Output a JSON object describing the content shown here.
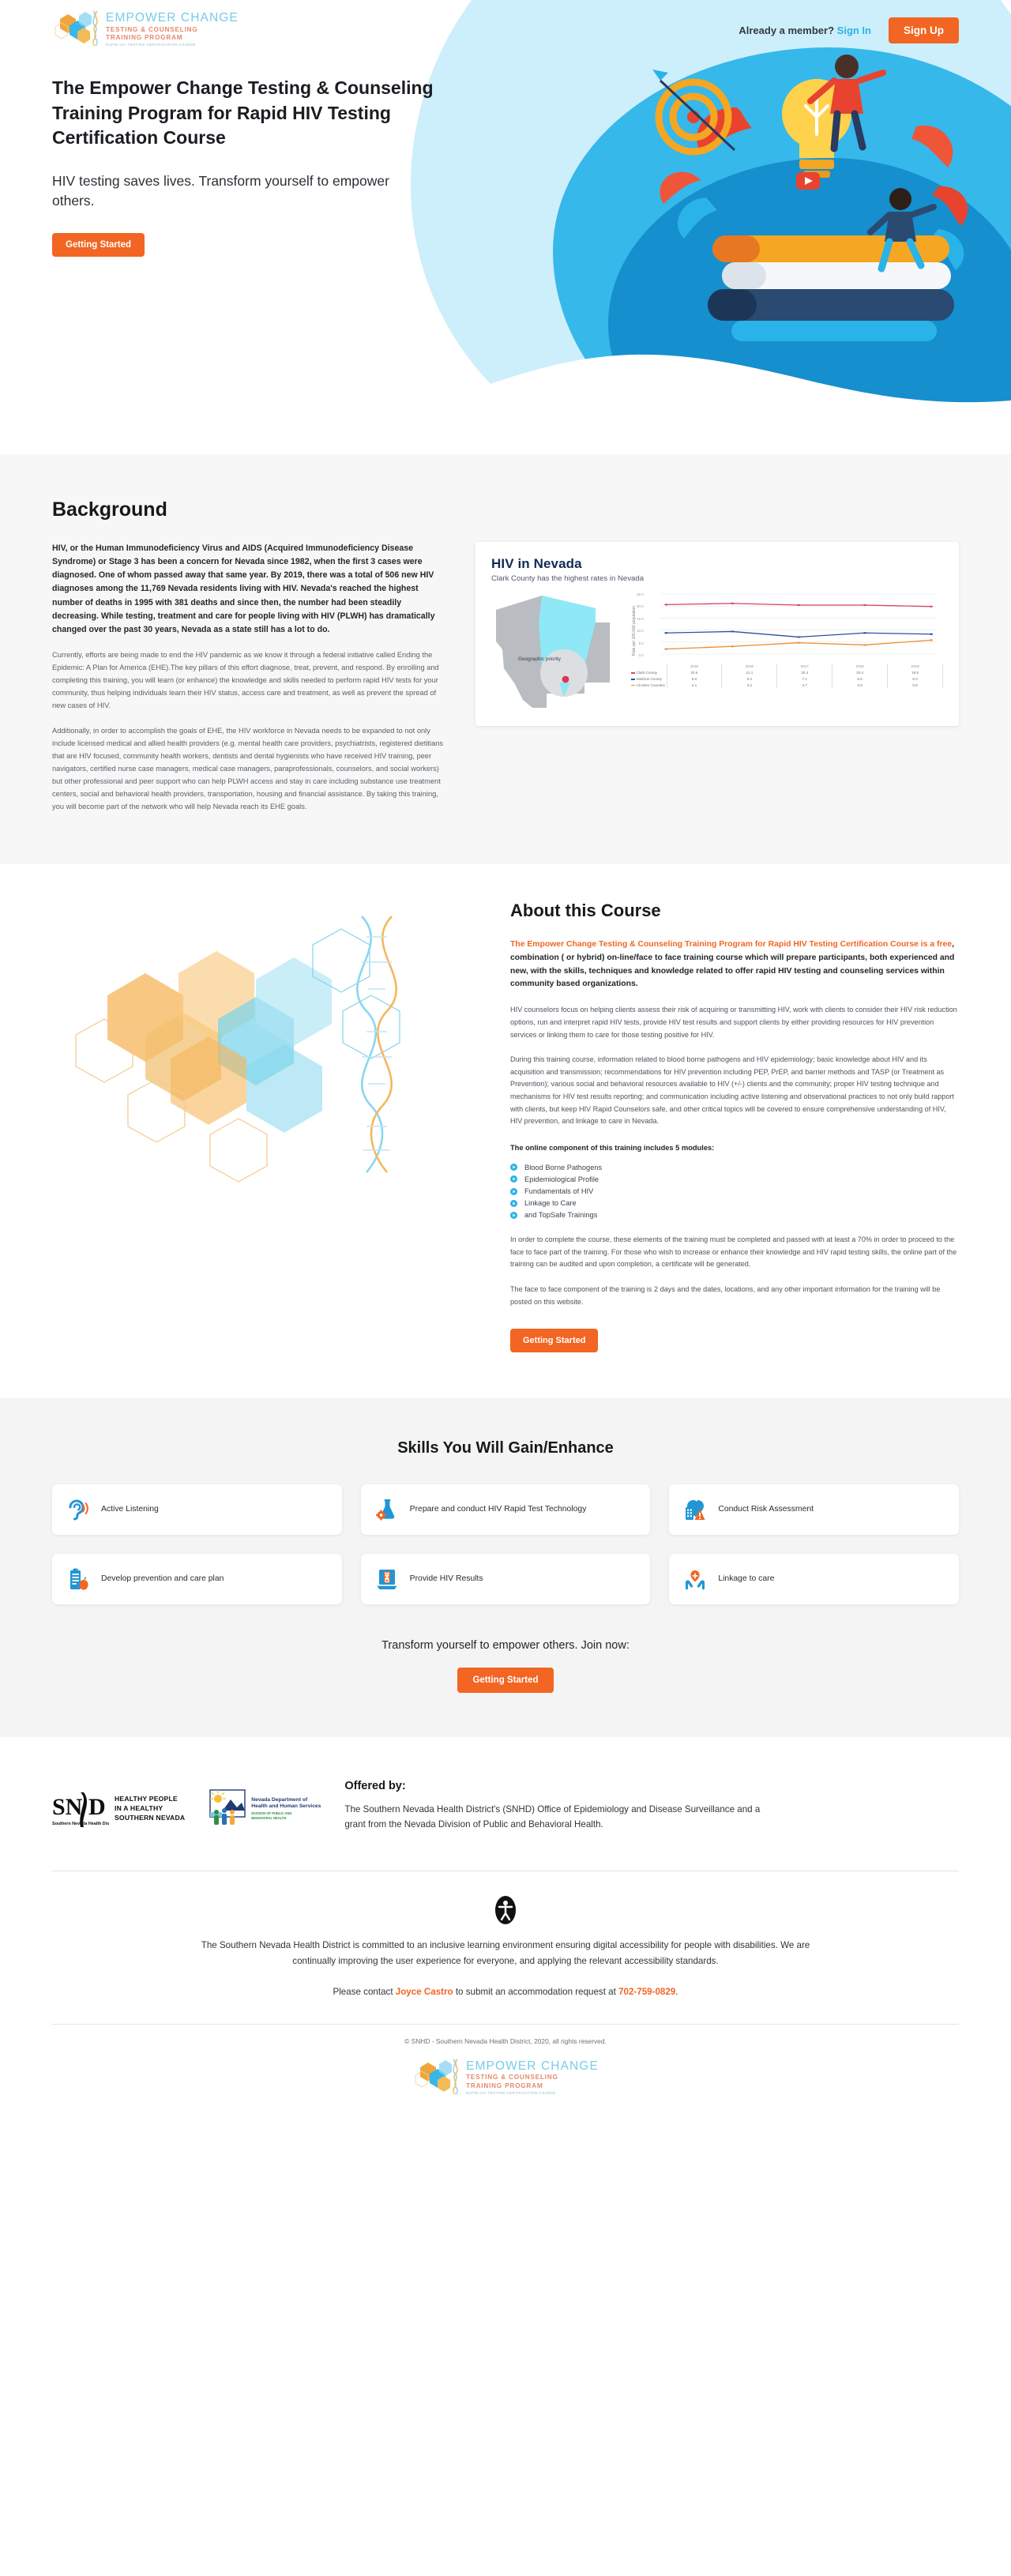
{
  "header": {
    "logo": {
      "line1": "EMPOWER CHANGE",
      "line2": "TESTING & COUNSELING",
      "line3": "TRAINING PROGRAM",
      "line4": "RAPID HIV TESTING CERTIFICATION COURSE"
    },
    "member_prompt": "Already a member?",
    "sign_in": "Sign In",
    "sign_up": "Sign Up"
  },
  "hero": {
    "title": "The Empower Change Testing & Counseling Training Program for Rapid HIV Testing Certification Course",
    "subtitle": "HIV testing saves lives. Transform yourself to empower others.",
    "cta": "Getting Started"
  },
  "background": {
    "title": "Background",
    "lead": "HIV, or the Human Immunodeficiency Virus and AIDS (Acquired Immunodeficiency Disease Syndrome) or Stage 3 has been a concern for Nevada since 1982, when the first 3 cases were diagnosed. One of whom passed away that same year. By 2019, there was a total of 506 new HIV diagnoses among the 11,769 Nevada residents living with HIV. Nevada's reached the highest number of deaths in 1995 with 381 deaths and since then, the number had been steadily decreasing. While testing, treatment and care for people living with HIV (PLWH) has dramatically changed over the past 30 years, Nevada as a state still has a lot to do.",
    "para2": "Currently, efforts are being made to end the HIV pandemic as we know it through a federal initiative called Ending the Epidemic: A Plan for America (EHE).The key pillars of this effort diagnose, treat, prevent, and respond. By enrolling and completing this training, you will learn (or enhance) the knowledge and skills needed to perform rapid HIV tests for your community,  thus helping individuals learn their HIV status, access care and treatment, as well as prevent the spread of new cases of HIV.",
    "para3": "Additionally, in order to accomplish the goals of EHE, the HIV workforce in Nevada needs to be expanded to not only include licensed medical and allied health  providers (e.g. mental health care providers, psychiatrists, registered dietitians that are HIV focused, community health workers, dentists and dental hygienists who have received HIV training, peer navigators, certified nurse case managers, medical case managers, paraprofessionals, counselors, and social workers) but other professional and peer support who can help PLWH access and stay in care including substance use treatment centers, social and behavioral health providers, transportation, housing and financial assistance. By taking this training, you will become part of the network who will help Nevada reach its EHE goals.",
    "map_label": "Geographic priority"
  },
  "chart_data": {
    "type": "line",
    "title": "HIV in Nevada",
    "subtitle": "Clark County has the highest rates in Nevada",
    "xlabel": "",
    "ylabel": "Rate per 100,000 population",
    "categories": [
      "2015",
      "2016",
      "2017",
      "2018",
      "2019"
    ],
    "ylim": [
      0.0,
      25.0
    ],
    "yticks": [
      "25.0",
      "20.0",
      "15.0",
      "10.0",
      "5.0",
      "0.0"
    ],
    "grid": true,
    "legend_position": "bottom-table",
    "series": [
      {
        "name": "Clark County",
        "values": [
          20.6,
          21.1,
          20.4,
          20.4,
          19.8
        ],
        "color": "#d6455f"
      },
      {
        "name": "Washoe County",
        "values": [
          8.8,
          9.4,
          7.1,
          8.8,
          8.3
        ],
        "color": "#2b4ea8"
      },
      {
        "name": "All other Counties",
        "values": [
          2.1,
          3.2,
          4.7,
          3.8,
          5.8
        ],
        "color": "#ef8b33"
      }
    ]
  },
  "about": {
    "title": "About this Course",
    "lead_highlight": "The Empower Change Testing & Counseling Training Program for Rapid HIV Testing Certification Course is a free",
    "lead_rest": ", combination ( or hybrid) on-line/face to face training course which will prepare participants, both experienced and new, with the skills, techniques and knowledge related to offer rapid HIV testing and counseling services within community based organizations.",
    "para2": "HIV counselors focus on helping clients assess their risk of acquiring or transmitting HIV, work with clients to consider their HIV risk reduction options, run and interpret rapid HIV tests, provide HIV test results and support clients by either providing resources for HIV prevention services or linking them to care for those testing positive for HIV.",
    "para3": "During this training course, information related to blood borne pathogens and HIV epidemiology; basic knowledge about HIV and its acquisition and transmission; recommendations for HIV prevention including PEP, PrEP, and barrier methods and TASP (or Treatment as Prevention); various social and behavioral resources available to HIV (+/-) clients and the community; proper HIV testing technique and  mechanisms for HIV test results reporting; and communication including active listening  and observational practices to not only build rapport with clients, but keep HIV Rapid Counselors safe, and other critical topics will be covered to ensure comprehensive understanding of HIV, HIV prevention, and linkage to care in Nevada.",
    "modules_head": "The online component of this training includes 5 modules:",
    "modules": [
      "Blood Borne Pathogens",
      "Epidemiological Profile",
      "Fundamentals of HIV",
      "Linkage to Care",
      "and TopSafe Trainings"
    ],
    "para4": "In order to complete the course, these elements of the training must be completed and passed with at least a 70% in order to proceed to the face to face part of the training. For those who wish to increase or enhance their knowledge and HIV rapid testing skills, the online part of the training can be audited and upon completion, a certificate will be generated.",
    "para5": "The face to face component of the training is 2 days and the dates, locations, and any other important information for the training will be posted on this website.",
    "cta": "Getting Started"
  },
  "skills": {
    "title": "Skills You Will Gain/Enhance",
    "items": [
      {
        "label": "Active Listening",
        "icon": "ear-listening-icon"
      },
      {
        "label": "Prepare and conduct HIV Rapid Test Technology",
        "icon": "flask-gear-icon"
      },
      {
        "label": "Conduct Risk Assessment",
        "icon": "clipboard-risk-icon"
      },
      {
        "label": "Develop prevention and care plan",
        "icon": "care-plan-icon"
      },
      {
        "label": "Provide HIV Results",
        "icon": "test-results-icon"
      },
      {
        "label": "Linkage to care",
        "icon": "hands-heart-icon"
      }
    ],
    "join_line": "Transform yourself to empower others. Join now:",
    "cta": "Getting Started"
  },
  "offered": {
    "snhd_tagline_l1": "HEALTHY PEOPLE",
    "snhd_tagline_l2": "IN A HEALTHY",
    "snhd_tagline_l3": "SOUTHERN NEVADA",
    "snhd_mark": "SNHD",
    "snhd_sub": "Southern Nevada Health District",
    "dhhs_l1": "Nevada Department of",
    "dhhs_l2": "Health and Human Services",
    "dhhs_l3": "DIVISION OF PUBLIC AND",
    "dhhs_l4": "BEHAVIORAL HEALTH",
    "head": "Offered by:",
    "body": "The Southern Nevada Health District's (SNHD) Office of Epidemiology and Disease Surveillance and a grant from the Nevada Division of Public and Behavioral Health."
  },
  "accessibility": {
    "icon": "accessibility-icon",
    "text": "The Southern Nevada Health District is committed to an inclusive learning environment ensuring digital accessibility for people with disabilities. We are continually improving the user experience for everyone, and applying the relevant accessibility standards.",
    "contact_pre": "Please contact ",
    "contact_name": "Joyce Castro",
    "contact_mid": " to submit an accommodation request at ",
    "contact_phone": "702-759-0829",
    "contact_post": "."
  },
  "footer": {
    "copyright": "© SNHD - Southern Nevada Health District, 2020, all rights reserved."
  },
  "colors": {
    "accent_orange": "#f26522",
    "accent_blue": "#29b3e8",
    "navy": "#132b56"
  }
}
